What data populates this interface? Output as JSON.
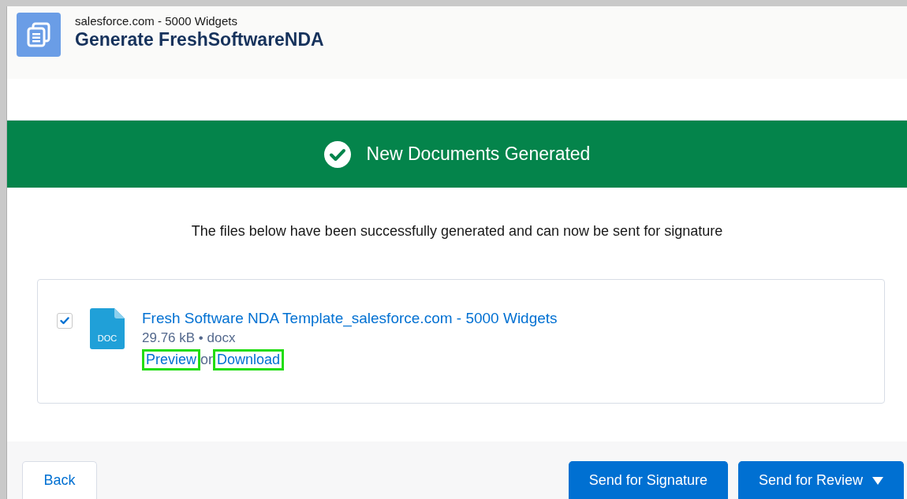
{
  "header": {
    "subtitle": "salesforce.com - 5000 Widgets",
    "title": "Generate FreshSoftwareNDA"
  },
  "banner": {
    "message": "New Documents Generated"
  },
  "description": "The files below have been successfully generated and can now be sent for signature",
  "files": [
    {
      "checked": true,
      "file_type_label": "DOC",
      "name": "Fresh Software NDA Template_salesforce.com - 5000 Widgets",
      "meta": "29.76 kB • docx",
      "links": [
        {
          "label": "Preview",
          "highlighted": true
        },
        {
          "label": "Download",
          "highlighted": true
        }
      ],
      "link_separator": "or"
    }
  ],
  "footer": {
    "back": "Back",
    "buttons": [
      {
        "label": "Send for Signature",
        "dropdown": false
      },
      {
        "label": "Send for Review",
        "dropdown": true
      }
    ]
  }
}
